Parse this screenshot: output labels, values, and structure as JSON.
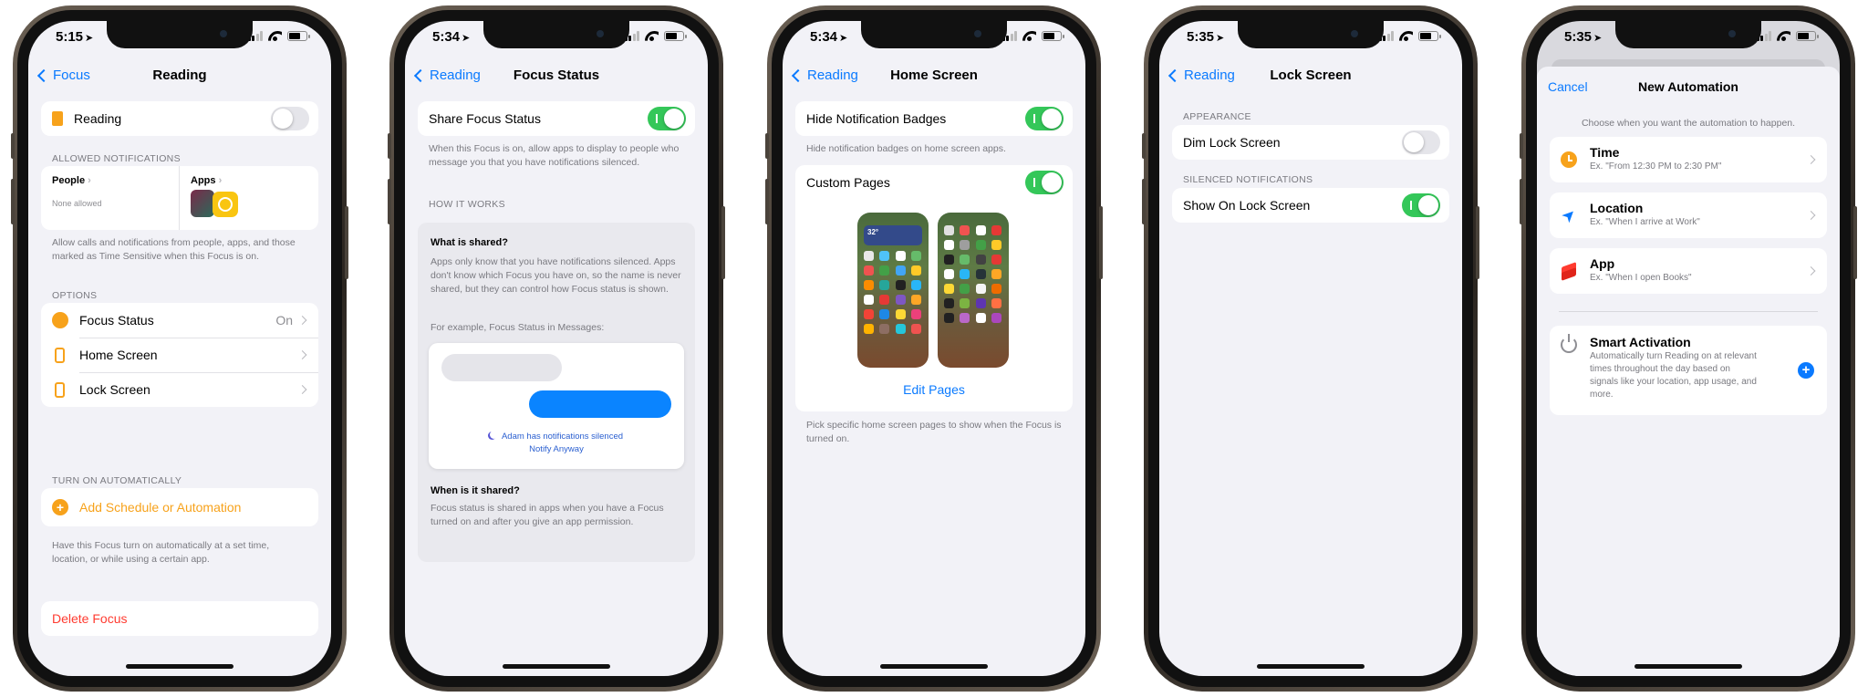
{
  "phone1": {
    "status": {
      "time": "5:15"
    },
    "nav": {
      "back": "Focus",
      "title": "Reading"
    },
    "focus_row": {
      "label": "Reading",
      "toggle_on": false
    },
    "allowed_header": "ALLOWED NOTIFICATIONS",
    "people": {
      "label": "People",
      "value": "None allowed"
    },
    "apps": {
      "label": "Apps"
    },
    "allowed_footer": "Allow calls and notifications from people, apps, and those marked as Time Sensitive when this Focus is on.",
    "options_header": "OPTIONS",
    "options": [
      {
        "label": "Focus Status",
        "value": "On"
      },
      {
        "label": "Home Screen",
        "value": ""
      },
      {
        "label": "Lock Screen",
        "value": ""
      }
    ],
    "auto_header": "TURN ON AUTOMATICALLY",
    "add_schedule": "Add Schedule or Automation",
    "auto_footer": "Have this Focus turn on automatically at a set time, location, or while using a certain app.",
    "delete": "Delete Focus"
  },
  "phone2": {
    "status": {
      "time": "5:34"
    },
    "nav": {
      "back": "Reading",
      "title": "Focus Status"
    },
    "share": {
      "label": "Share Focus Status",
      "toggle_on": true
    },
    "share_footer": "When this Focus is on, allow apps to display to people who message you that you have notifications silenced.",
    "how_header": "HOW IT WORKS",
    "what_title": "What is shared?",
    "what_body": "Apps only know that you have notifications silenced. Apps don't know which Focus you have on, so the name is never shared, but they can control how Focus status is shown.",
    "example": "For example, Focus Status in Messages:",
    "silenced": "Adam has notifications silenced",
    "notify": "Notify Anyway",
    "when_title": "When is it shared?",
    "when_body": "Focus status is shared in apps when you have a Focus turned on and after you give an app permission."
  },
  "phone3": {
    "status": {
      "time": "5:34"
    },
    "nav": {
      "back": "Reading",
      "title": "Home Screen"
    },
    "badges": {
      "label": "Hide Notification Badges",
      "toggle_on": true
    },
    "badges_footer": "Hide notification badges on home screen apps.",
    "custom": {
      "label": "Custom Pages",
      "toggle_on": true
    },
    "widget_temp": "32°",
    "edit": "Edit Pages",
    "custom_footer": "Pick specific home screen pages to show when the Focus is turned on."
  },
  "phone4": {
    "status": {
      "time": "5:35"
    },
    "nav": {
      "back": "Reading",
      "title": "Lock Screen"
    },
    "appearance_header": "APPEARANCE",
    "dim": {
      "label": "Dim Lock Screen",
      "toggle_on": false
    },
    "silenced_header": "SILENCED NOTIFICATIONS",
    "show": {
      "label": "Show On Lock Screen",
      "toggle_on": true
    }
  },
  "phone5": {
    "status": {
      "time": "5:35"
    },
    "nav": {
      "cancel": "Cancel",
      "title": "New Automation"
    },
    "prompt": "Choose when you want the automation to happen.",
    "triggers": [
      {
        "title": "Time",
        "sub": "Ex. \"From 12:30 PM to 2:30 PM\"",
        "icon": "clock-icon",
        "color": "#f7a21b"
      },
      {
        "title": "Location",
        "sub": "Ex. \"When I arrive at Work\"",
        "icon": "location-arrow-icon",
        "color": "#0a7aff"
      },
      {
        "title": "App",
        "sub": "Ex. \"When I open Books\"",
        "icon": "layers-icon",
        "color": "#ff3b30"
      }
    ],
    "smart": {
      "title": "Smart Activation",
      "body": "Automatically turn Reading on at relevant times throughout the day based on signals like your location, app usage, and more."
    }
  },
  "colors": {
    "accent": "#0a7aff",
    "toggle_on": "#34c759",
    "destructive": "#ff3b30",
    "orange": "#f7a21b"
  }
}
